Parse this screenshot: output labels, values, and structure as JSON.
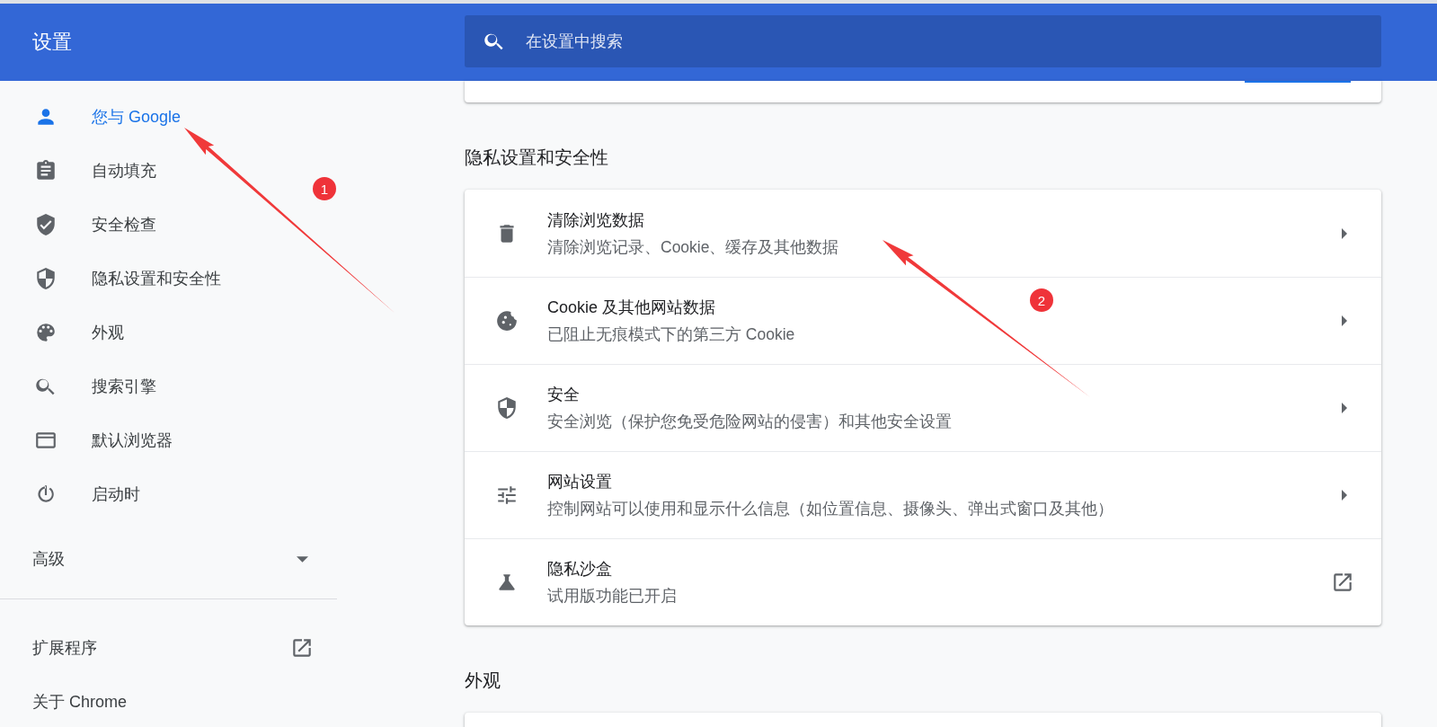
{
  "header": {
    "title": "设置",
    "search": {
      "placeholder": "在设置中搜索"
    }
  },
  "sidebar": {
    "items": [
      {
        "label": "您与 Google",
        "selected": true
      },
      {
        "label": "自动填充",
        "selected": false
      },
      {
        "label": "安全检查",
        "selected": false
      },
      {
        "label": "隐私设置和安全性",
        "selected": false
      },
      {
        "label": "外观",
        "selected": false
      },
      {
        "label": "搜索引擎",
        "selected": false
      },
      {
        "label": "默认浏览器",
        "selected": false
      },
      {
        "label": "启动时",
        "selected": false
      }
    ],
    "advanced": {
      "label": "高级",
      "expanded": false
    },
    "links": [
      {
        "label": "扩展程序",
        "external": true
      },
      {
        "label": "关于 Chrome",
        "external": false
      }
    ]
  },
  "sections": [
    {
      "title": "隐私设置和安全性",
      "rows": [
        {
          "title": "清除浏览数据",
          "subtitle": "清除浏览记录、Cookie、缓存及其他数据",
          "external": false
        },
        {
          "title": "Cookie 及其他网站数据",
          "subtitle": "已阻止无痕模式下的第三方 Cookie",
          "external": false
        },
        {
          "title": "安全",
          "subtitle": "安全浏览（保护您免受危险网站的侵害）和其他安全设置",
          "external": false
        },
        {
          "title": "网站设置",
          "subtitle": "控制网站可以使用和显示什么信息（如位置信息、摄像头、弹出式窗口及其他）",
          "external": false
        },
        {
          "title": "隐私沙盒",
          "subtitle": "试用版功能已开启",
          "external": true
        }
      ]
    },
    {
      "title": "外观"
    }
  ],
  "annotations": [
    {
      "number": "1"
    },
    {
      "number": "2"
    }
  ]
}
